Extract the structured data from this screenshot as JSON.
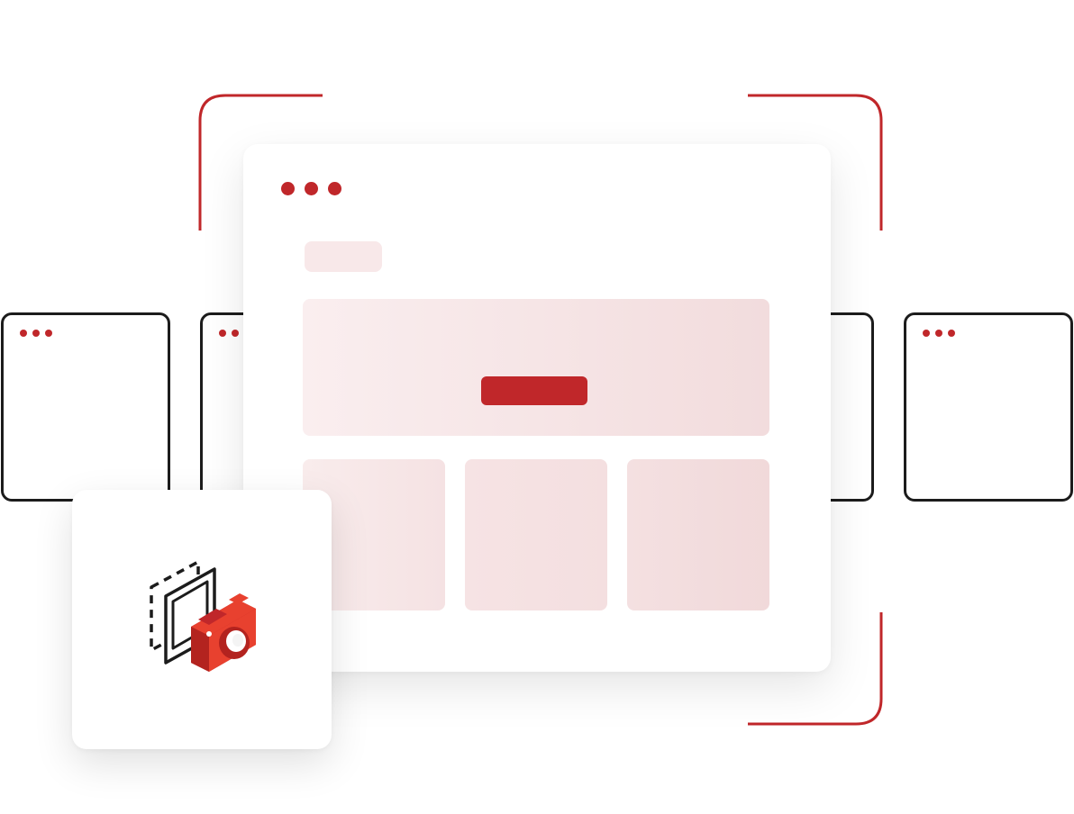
{
  "colors": {
    "accent": "#c0272a",
    "outline": "#1c1c1c",
    "placeholder_light": "#f8e8e9",
    "placeholder_dark": "#f1d9da",
    "camera_body": "#e8412f"
  },
  "background_windows": [
    {
      "name": "window-far-left"
    },
    {
      "name": "window-left"
    },
    {
      "name": "window-right"
    },
    {
      "name": "window-far-right"
    }
  ],
  "main_window": {
    "dots": 3,
    "content_blocks": [
      "pill-placeholder",
      "hero-banner",
      "tile-1",
      "tile-2",
      "tile-3"
    ]
  },
  "icons": {
    "camera": "screenshot-camera-icon",
    "corners": "capture-frame-corners"
  }
}
